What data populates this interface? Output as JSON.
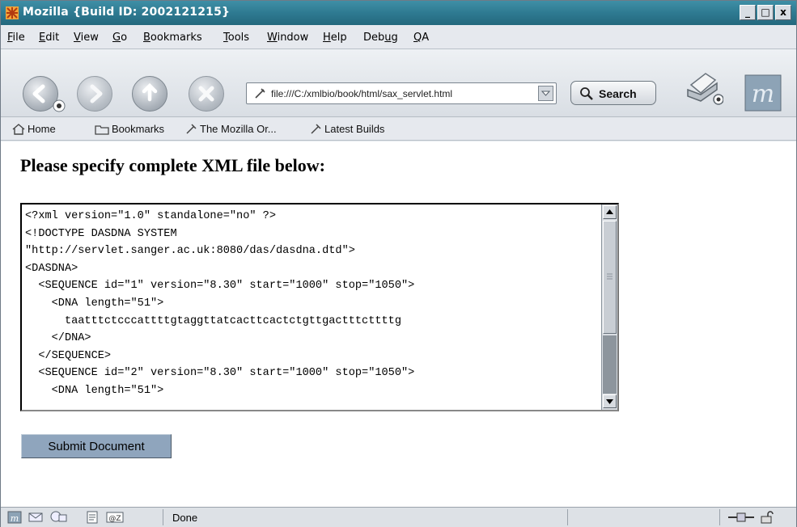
{
  "window": {
    "title": "Mozilla {Build ID: 2002121215}",
    "controls": {
      "minimize": "_",
      "maximize": "□",
      "close": "x"
    }
  },
  "menubar": {
    "items": [
      {
        "label_u": "F",
        "label_rest": "ile"
      },
      {
        "label_u": "E",
        "label_rest": "dit"
      },
      {
        "label_u": "V",
        "label_rest": "iew"
      },
      {
        "label_u": "G",
        "label_rest": "o"
      },
      {
        "label_u": "B",
        "label_rest": "ookmarks"
      },
      {
        "label_u": "T",
        "label_rest": "ools"
      },
      {
        "label_u": "W",
        "label_rest": "indow"
      },
      {
        "label_u": "H",
        "label_rest": "elp"
      },
      {
        "label_pre": "Deb",
        "label_u": "u",
        "label_rest": "g"
      },
      {
        "label_u": "Q",
        "label_rest": "A"
      }
    ]
  },
  "navbar": {
    "buttons": [
      "back-icon",
      "forward-icon",
      "reload-icon",
      "stop-icon"
    ],
    "url": "file:///C:/xmlbio/book/html/sax_servlet.html",
    "search_label": "Search"
  },
  "personal_toolbar": {
    "home": "Home",
    "bookmarks": "Bookmarks",
    "mozilla_org": "The Mozilla Or...",
    "latest_builds": "Latest Builds"
  },
  "content": {
    "heading": "Please specify complete XML file below:",
    "xml_text": "<?xml version=\"1.0\" standalone=\"no\" ?>\n<!DOCTYPE DASDNA SYSTEM\n\"http://servlet.sanger.ac.uk:8080/das/dasdna.dtd\">\n<DASDNA>\n  <SEQUENCE id=\"1\" version=\"8.30\" start=\"1000\" stop=\"1050\">\n    <DNA length=\"51\">\n      taatttctcccattttgtaggttatcacttcactctgttgactttcttttg\n    </DNA>\n  </SEQUENCE>\n  <SEQUENCE id=\"2\" version=\"8.30\" start=\"1000\" stop=\"1050\">\n    <DNA length=\"51\">",
    "submit_label": "Submit Document"
  },
  "statusbar": {
    "status": "Done"
  },
  "colors": {
    "titlebar": "#2e7a91",
    "submit_button": "#8fa5bd"
  }
}
